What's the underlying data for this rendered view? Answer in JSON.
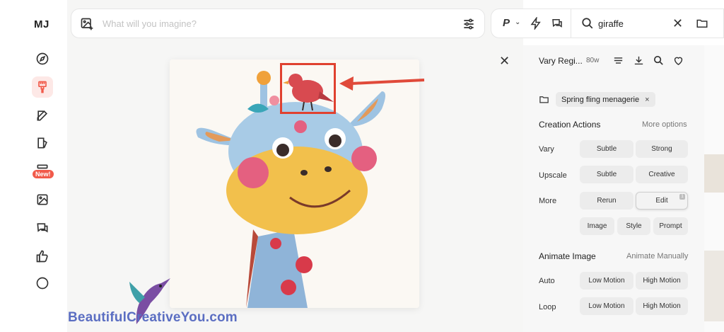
{
  "app": {
    "logo": "MJ",
    "new_badge": "New!"
  },
  "sidebar": {
    "icons": [
      "explore-icon",
      "create-icon",
      "edit-icon",
      "organize-icon",
      "feature-icon",
      "image-icon",
      "chat-icon",
      "rate-icon",
      "help-icon"
    ]
  },
  "search": {
    "placeholder": "What will you imagine?"
  },
  "mode": {
    "label": "P",
    "chevron": "⌄"
  },
  "query": {
    "text": "giraffe",
    "close": "✕"
  },
  "viewer": {
    "close": "✕"
  },
  "panel": {
    "title": "Vary Regi...",
    "aspect": "80w",
    "folder_chip": "Spring fling menagerie",
    "chip_close": "×",
    "creation_actions": {
      "heading": "Creation Actions",
      "more": "More options",
      "rows": [
        {
          "label": "Vary",
          "buttons": [
            "Subtle",
            "Strong"
          ]
        },
        {
          "label": "Upscale",
          "buttons": [
            "Subtle",
            "Creative"
          ]
        },
        {
          "label": "More",
          "buttons": [
            "Rerun",
            "Edit"
          ]
        },
        {
          "label": "",
          "buttons": [
            "Image",
            "Style",
            "Prompt"
          ]
        }
      ],
      "edit_count": "1"
    },
    "animate": {
      "heading": "Animate Image",
      "more": "Animate Manually",
      "rows": [
        {
          "label": "Auto",
          "buttons": [
            "Low Motion",
            "High Motion"
          ]
        },
        {
          "label": "Loop",
          "buttons": [
            "Low Motion",
            "High Motion"
          ]
        }
      ]
    }
  },
  "watermark": {
    "text": "BeautifulCreativeYou.com"
  },
  "colors": {
    "accent": "#f15a4a",
    "highlight_red": "#e0412f",
    "watermark_blue": "#5b6ec2"
  }
}
